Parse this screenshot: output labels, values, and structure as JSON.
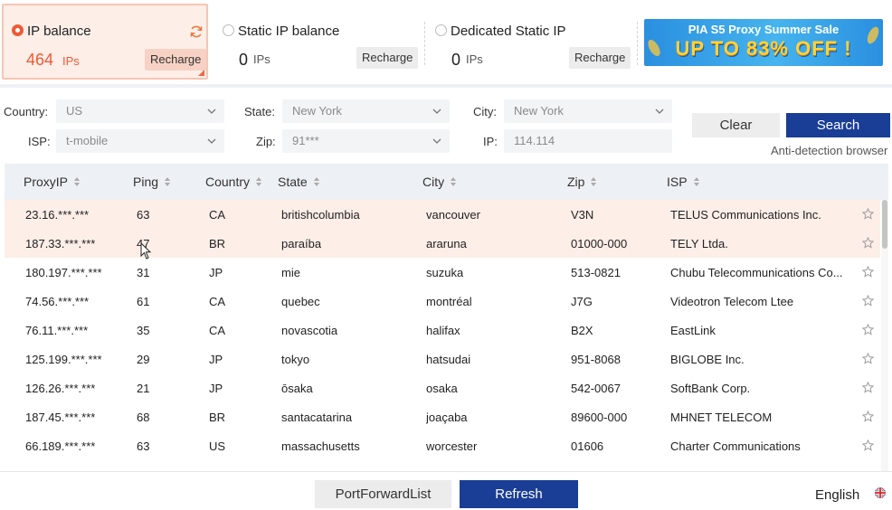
{
  "balances": {
    "ip": {
      "label": "IP balance",
      "value": "464",
      "unit": "IPs",
      "recharge": "Recharge",
      "selected": true
    },
    "static": {
      "label": "Static IP balance",
      "value": "0",
      "unit": "IPs",
      "recharge": "Recharge",
      "selected": false
    },
    "dedicated": {
      "label": "Dedicated Static IP",
      "value": "0",
      "unit": "IPs",
      "recharge": "Recharge",
      "selected": false
    }
  },
  "banner": {
    "line1": "PIA S5 Proxy Summer Sale",
    "line2": "UP TO 83% OFF !"
  },
  "filters": {
    "country": {
      "label": "Country:",
      "value": "US"
    },
    "state": {
      "label": "State:",
      "value": "New York"
    },
    "city": {
      "label": "City:",
      "value": "New York"
    },
    "isp": {
      "label": "ISP:",
      "value": "t-mobile"
    },
    "zip": {
      "label": "Zip:",
      "value": "91***"
    },
    "ip": {
      "label": "IP:",
      "value": "114.114"
    }
  },
  "actions": {
    "clear": "Clear",
    "search": "Search",
    "anti_detection": "Anti-detection browser"
  },
  "table": {
    "headers": [
      "ProxyIP",
      "Ping",
      "Country",
      "State",
      "City",
      "Zip",
      "ISP"
    ],
    "rows": [
      {
        "ip": "23.16.***.***",
        "ping": "63",
        "country": "CA",
        "state": "britishcolumbia",
        "city": "vancouver",
        "zip": "V3N",
        "isp": "TELUS Communications Inc.",
        "selected": true
      },
      {
        "ip": "187.33.***.***",
        "ping": "47",
        "country": "BR",
        "state": "paraíba",
        "city": "araruna",
        "zip": "01000-000",
        "isp": "TELY Ltda.",
        "selected": true
      },
      {
        "ip": "180.197.***.***",
        "ping": "31",
        "country": "JP",
        "state": "mie",
        "city": "suzuka",
        "zip": "513-0821",
        "isp": "Chubu Telecommunications Co...",
        "selected": false
      },
      {
        "ip": "74.56.***.***",
        "ping": "61",
        "country": "CA",
        "state": "quebec",
        "city": "montréal",
        "zip": "J7G",
        "isp": "Videotron Telecom Ltee",
        "selected": false
      },
      {
        "ip": "76.11.***.***",
        "ping": "35",
        "country": "CA",
        "state": "novascotia",
        "city": "halifax",
        "zip": "B2X",
        "isp": "EastLink",
        "selected": false
      },
      {
        "ip": "125.199.***.***",
        "ping": "29",
        "country": "JP",
        "state": "tokyo",
        "city": "hatsudai",
        "zip": "951-8068",
        "isp": "BIGLOBE Inc.",
        "selected": false
      },
      {
        "ip": "126.26.***.***",
        "ping": "21",
        "country": "JP",
        "state": "ōsaka",
        "city": "osaka",
        "zip": "542-0067",
        "isp": "SoftBank Corp.",
        "selected": false
      },
      {
        "ip": "187.45.***.***",
        "ping": "68",
        "country": "BR",
        "state": "santacatarina",
        "city": "joaçaba",
        "zip": "89600-000",
        "isp": "MHNET TELECOM",
        "selected": false
      },
      {
        "ip": "66.189.***.***",
        "ping": "63",
        "country": "US",
        "state": "massachusetts",
        "city": "worcester",
        "zip": "01606",
        "isp": "Charter Communications",
        "selected": false
      }
    ]
  },
  "footer": {
    "port_forward": "PortForwardList",
    "refresh": "Refresh",
    "language": "English"
  },
  "colors": {
    "accent": "#ee5a34",
    "primary": "#1a3e95",
    "selected_row": "#fdeee8"
  }
}
